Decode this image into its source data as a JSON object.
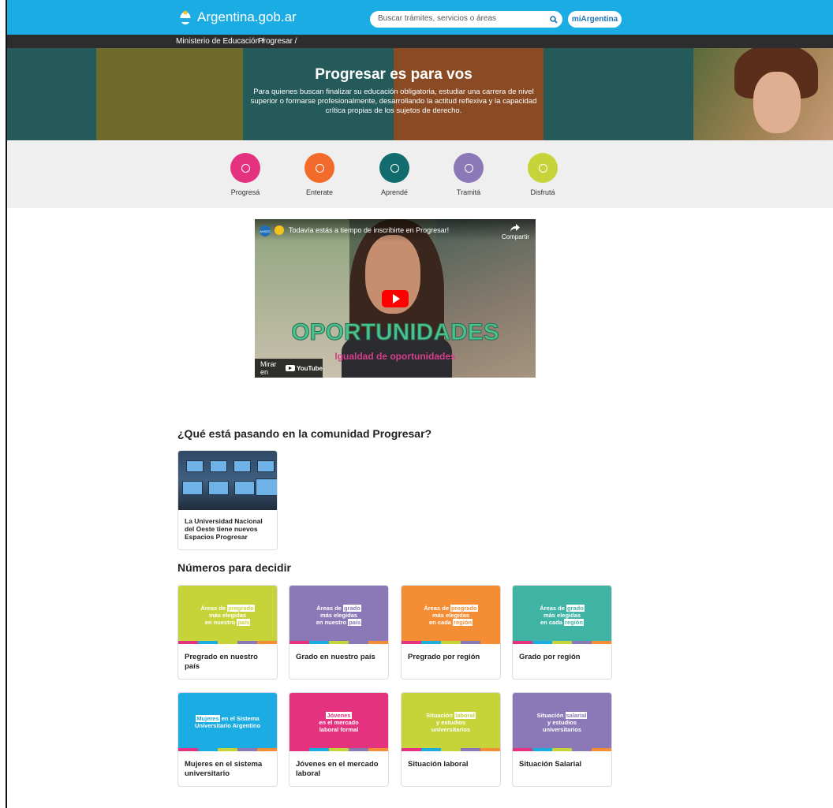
{
  "header": {
    "brand": "Argentina.gob.ar",
    "search_placeholder": "Buscar trámites, servicios o áreas",
    "account_button": "miArgentina"
  },
  "breadcrumb": [
    "Ministerio de Educación /",
    "Progresar /"
  ],
  "hero": {
    "title": "Progresar es para vos",
    "text": "Para quienes buscan finalizar su educación obligatoria, estudiar una carrera de nivel superior o formarse profesionalmente, desarrollando la actitud reflexiva y la capacidad crítica propias de los sujetos de derecho."
  },
  "nav": [
    {
      "label": "Progresá",
      "color": "#e5327f"
    },
    {
      "label": "Enterate",
      "color": "#f26b2a"
    },
    {
      "label": "Aprendé",
      "color": "#126c6d"
    },
    {
      "label": "Tramitá",
      "color": "#8a79b6"
    },
    {
      "label": "Disfrutá",
      "color": "#c6d43a"
    }
  ],
  "video": {
    "title": "Todavía estás a tiempo de inscribirte en Progresar!",
    "channel": "ANSES",
    "share": "Compartir",
    "overlay_title": "OPORTUNIDADES",
    "overlay_subtitle": "Igualdad de oportunidades",
    "watch_on": "Mirar en",
    "youtube": "YouTube"
  },
  "community": {
    "heading": "¿Qué está pasando en la comunidad Progresar?",
    "items": [
      {
        "text": "La Universidad Nacional del Oeste tiene nuevos Espacios Progresar"
      }
    ]
  },
  "numbers": {
    "heading": "Números para decidir",
    "cards": [
      {
        "pre": "Áreas de",
        "hl": "pregrado",
        "l2": "más elegidas",
        "l3pre": "en nuestro",
        "l3hl": "país",
        "caption": "Pregrado en nuestro país",
        "color": "#c6d43a",
        "hlcolor": "#c6d43a"
      },
      {
        "pre": "Áreas de",
        "hl": "grado",
        "l2": "más elegidas",
        "l3pre": "en nuestro",
        "l3hl": "país",
        "caption": "Grado en nuestro país",
        "color": "#8a79b6",
        "hlcolor": "#8a79b6"
      },
      {
        "pre": "Áreas de",
        "hl": "pregrado",
        "l2": "más elegidas",
        "l3pre": "en cada",
        "l3hl": "región",
        "caption": "Pregrado por región",
        "color": "#f58d34",
        "hlcolor": "#f58d34"
      },
      {
        "pre": "Áreas de",
        "hl": "grado",
        "l2": "más elegidas",
        "l3pre": "en cada",
        "l3hl": "región",
        "caption": "Grado por región",
        "color": "#3fb3a4",
        "hlcolor": "#3fb3a4"
      },
      {
        "pre": "",
        "hl": "Mujeres",
        "l2": "Universitario Argentino",
        "l3pre": "",
        "l3hl": "",
        "post": " en el Sistema",
        "caption": "Mujeres en el sistema universitario",
        "color": "#1aace3",
        "hlcolor": "#1aace3"
      },
      {
        "pre": "",
        "hl": "Jóvenes",
        "l2": "en el mercado",
        "l3pre": "laboral formal",
        "l3hl": "",
        "caption": "Jóvenes en el mercado laboral",
        "color": "#e5327f",
        "hlcolor": "#e5327f"
      },
      {
        "pre": "Situación",
        "hl": "laboral",
        "l2": "y estudios",
        "l3pre": "universitarios",
        "l3hl": "",
        "caption": "Situación laboral",
        "color": "#c6d43a",
        "hlcolor": "#c6d43a"
      },
      {
        "pre": "Situación",
        "hl": "salarial",
        "l2": "y estudios",
        "l3pre": "universitarios",
        "l3hl": "",
        "caption": "Situación Salarial",
        "color": "#8a79b6",
        "hlcolor": "#8a79b6"
      }
    ]
  },
  "colors": {
    "topbar": "#1aace3",
    "breadcrumb_bg": "#2d2d2d",
    "bars": [
      "#e5327f",
      "#1aace3",
      "#c6d43a",
      "#8a79b6",
      "#f58d34"
    ]
  }
}
